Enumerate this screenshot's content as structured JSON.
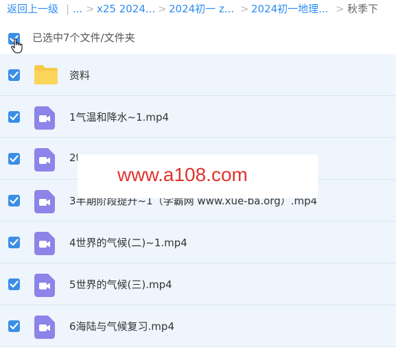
{
  "breadcrumb": {
    "back": "返回上一级",
    "divider": "|",
    "ellipsis": "...",
    "sep": ">",
    "items": [
      "x25 2024...",
      "2024初一 z...",
      "2024初一地理..."
    ],
    "current": "秋季下"
  },
  "selection": {
    "label": "已选中7个文件/文件夹",
    "checked": true
  },
  "files": [
    {
      "name": "资料",
      "type": "folder",
      "checked": true
    },
    {
      "name": "1气温和降水~1.mp4",
      "type": "video",
      "checked": true
    },
    {
      "name": "2t",
      "type": "video",
      "checked": true
    },
    {
      "name": "3半期阶段提升~1（学霸网 www.xue-ba.org）.mp4",
      "type": "video",
      "checked": true
    },
    {
      "name": "4世界的气候(二)~1.mp4",
      "type": "video",
      "checked": true
    },
    {
      "name": "5世界的气候(三).mp4",
      "type": "video",
      "checked": true
    },
    {
      "name": "6海陆与气候复习.mp4",
      "type": "video",
      "checked": true
    }
  ],
  "watermark": "www.a108.com",
  "colors": {
    "accent": "#3a8ee6",
    "row_bg": "#eef5fc",
    "video_icon": "#8c84e8",
    "folder_icon": "#f7c948",
    "watermark_text": "#e0332d"
  }
}
